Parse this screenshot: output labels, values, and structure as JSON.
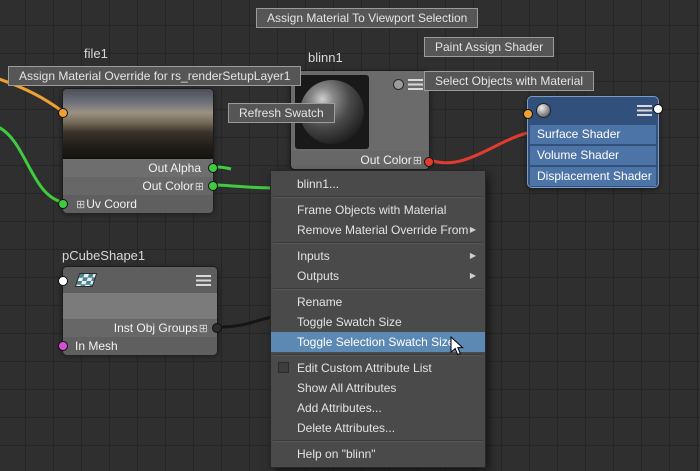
{
  "floating_buttons": {
    "assign_viewport": "Assign Material To Viewport Selection",
    "paint_assign": "Paint Assign Shader",
    "assign_override": "Assign Material Override for rs_renderSetupLayer1",
    "select_objects": "Select Objects with Material",
    "refresh_swatch": "Refresh Swatch"
  },
  "nodes": {
    "file1": {
      "title": "file1",
      "out_alpha": "Out Alpha",
      "out_color": "Out Color",
      "uv_coord": "Uv Coord"
    },
    "blinn1": {
      "title": "blinn1",
      "out_color": "Out Color"
    },
    "pcube": {
      "title": "pCubeShape1",
      "inst_obj_groups": "Inst Obj Groups",
      "in_mesh": "In Mesh"
    },
    "shading_group": {
      "surface": "Surface Shader",
      "volume": "Volume Shader",
      "displacement": "Displacement Shader"
    }
  },
  "icons": {
    "expand": "⊞",
    "submenu_arrow": "▶"
  },
  "menu": {
    "title": "blinn1...",
    "items": [
      {
        "label": "Frame Objects with Material"
      },
      {
        "label": "Remove Material Override From",
        "submenu": true
      },
      {
        "label": "Inputs",
        "submenu": true
      },
      {
        "label": "Outputs",
        "submenu": true
      },
      {
        "label": "Rename"
      },
      {
        "label": "Toggle Swatch Size"
      },
      {
        "label": "Toggle Selection Swatch Size",
        "highlighted": true
      },
      {
        "label": "Edit Custom Attribute List",
        "checkbox": true
      },
      {
        "label": "Show All Attributes"
      },
      {
        "label": "Add Attributes..."
      },
      {
        "label": "Delete Attributes..."
      },
      {
        "label": "Help on \"blinn\""
      }
    ]
  },
  "colors": {
    "canvas_bg": "#2f2f2f",
    "grid_line": "#262626",
    "menu_highlight": "#5c89b4",
    "node_gray": "#6b6b6b",
    "node_blue": "#31507c",
    "row_blue": "#4d74a6",
    "wire_green": "#3fca3f",
    "wire_orange": "#f0a030",
    "wire_red": "#e23c30",
    "wire_dark": "#151515",
    "port_magenta": "#d64fd6",
    "port_white": "#ffffff",
    "port_gray": "#9c9c9c"
  }
}
